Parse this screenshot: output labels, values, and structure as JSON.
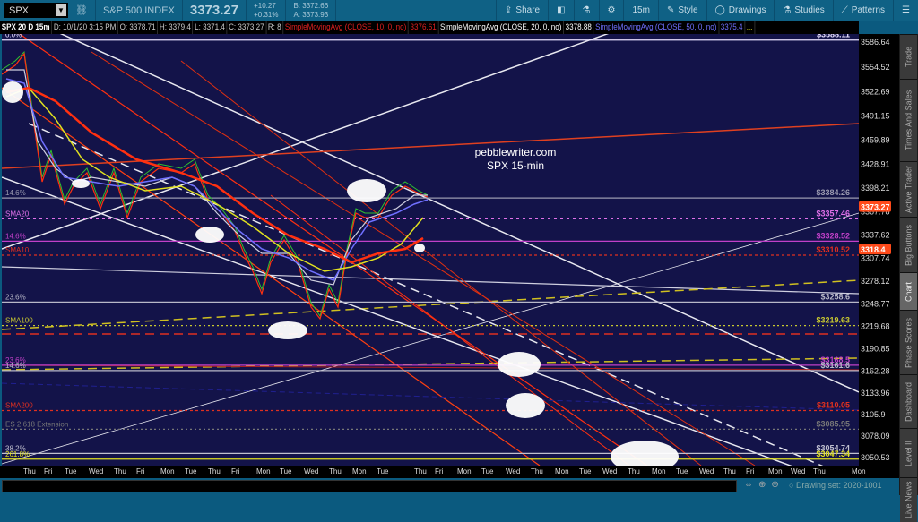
{
  "header": {
    "symbol": "SPX",
    "name": "S&P 500 INDEX",
    "last": "3373.27",
    "change": "+10.27",
    "change_pct": "+0.31%",
    "bid": "B: 3372.66",
    "ask": "A: 3373.93",
    "toolbar": [
      {
        "label": "Share",
        "icon": "share-icon"
      },
      {
        "label": "",
        "icon": "alert-icon"
      },
      {
        "label": "",
        "icon": "flask-icon"
      },
      {
        "label": "",
        "icon": "gear-icon"
      },
      {
        "label": "15m",
        "icon": ""
      },
      {
        "label": "Style",
        "icon": "style-icon"
      },
      {
        "label": "Drawings",
        "icon": "ellipse-icon"
      },
      {
        "label": "Studies",
        "icon": "flask-icon"
      },
      {
        "label": "Patterns",
        "icon": "patterns-icon"
      },
      {
        "label": "☰",
        "icon": "menu-icon"
      }
    ]
  },
  "info": {
    "title": "SPX 20 D 15m",
    "date": "D: 10/1/20 3:15 PM",
    "open": "O: 3378.71",
    "high": "H: 3379.4",
    "low": "L: 3371.4",
    "close": "C: 3373.27",
    "range": "R: 8",
    "sma10": "SimpleMovingAvg (CLOSE, 10, 0, no)",
    "sma10_val": "3376.61",
    "sma20": "SimpleMovingAvg (CLOSE, 20, 0, no)",
    "sma20_val": "3378.88",
    "sma50": "SimpleMovingAvg (CLOSE, 50, 0, no)",
    "sma50_val": "3375.4",
    "more": "..."
  },
  "chart": {
    "watermark": [
      "pebblewriter.com",
      "SPX 15-min"
    ],
    "y_ticks": [
      "3586.64",
      "3554.52",
      "3522.69",
      "3491.15",
      "3459.89",
      "3428.91",
      "3398.21",
      "3367.78",
      "3337.62",
      "3307.74",
      "3278.12",
      "3248.77",
      "3219.68",
      "3190.85",
      "3162.28",
      "3133.96",
      "3105.9",
      "3078.09",
      "3050.53"
    ],
    "price_badges": [
      {
        "value": "3373.27",
        "color": "#ff4a1a"
      },
      {
        "value": "3318.4",
        "color": "#ff4a1a"
      }
    ],
    "levels": [
      {
        "left": "0.0%",
        "right": "$3588.11",
        "price": 3588.11,
        "color": "#e8e0ff",
        "dash": ""
      },
      {
        "left": "14.6%",
        "right": "$3384.26",
        "price": 3384.26,
        "color": "#9a9ab0",
        "dash": ""
      },
      {
        "left": "SMA20",
        "right": "$3357.46",
        "price": 3357.46,
        "color": "#e070e8",
        "dash": "3,4"
      },
      {
        "left": "14.6%",
        "right": "$3328.52",
        "price": 3328.52,
        "color": "#c040c8",
        "dash": ""
      },
      {
        "left": "SMA10",
        "right": "$3310.52",
        "price": 3310.52,
        "color": "#e03020",
        "dash": "3,3"
      },
      {
        "left": "23.6%",
        "right": "$3258.6",
        "price": 3250.0,
        "color": "#b8b8c8",
        "dash": ""
      },
      {
        "left": "SMA100",
        "right": "$3219.63",
        "price": 3219.63,
        "color": "#c8c830",
        "dash": "2,3"
      },
      {
        "left": "23.6%",
        "right": "$3168.5",
        "price": 3168.5,
        "color": "#c040c8",
        "dash": ""
      },
      {
        "left": "14.6%",
        "right": "$3161.6",
        "price": 3161.6,
        "color": "#b8b8c8",
        "dash": ""
      },
      {
        "left": "SMA200",
        "right": "$3110.05",
        "price": 3110.05,
        "color": "#e03020",
        "dash": "3,3"
      },
      {
        "left": "ES 2.618 Extension",
        "right": "$3085.95",
        "price": 3085.95,
        "color": "#777",
        "dash": "2,3"
      },
      {
        "left": "38.2%",
        "right": "$3054.74",
        "price": 3054.74,
        "color": "#c0c0d0",
        "dash": ""
      },
      {
        "left": "261.8%",
        "right": "$3047.34",
        "price": 3047.34,
        "color": "#e0e020",
        "dash": ""
      }
    ],
    "x_ticks": [
      "Thu",
      "Fri",
      "Tue",
      "Wed",
      "Thu",
      "Fri",
      "Mon",
      "Tue",
      "Thu",
      "Fri",
      "Mon",
      "Tue",
      "Wed",
      "Thu",
      "Mon",
      "Tue",
      "Thu",
      "Fri",
      "Mon",
      "Tue",
      "Wed",
      "Thu",
      "Mon",
      "Tue",
      "Wed",
      "Thu",
      "Mon",
      "Tue",
      "Wed",
      "Thu",
      "Fri",
      "Mon",
      "Wed",
      "Thu",
      "Mon"
    ]
  },
  "tabs": [
    "Trade",
    "Times And Sales",
    "Active Trader",
    "Big Buttons",
    "Chart",
    "Phase Scores",
    "Dashboard",
    "Level II",
    "Live News"
  ],
  "footer": {
    "drawing_set": "Drawing set: 2020-1001"
  }
}
